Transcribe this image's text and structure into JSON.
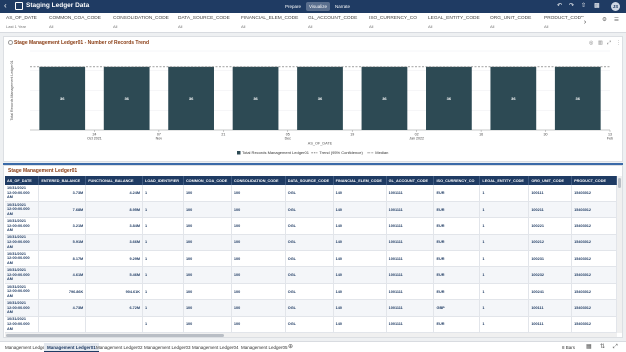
{
  "app": {
    "back_icon": "back-arrow-icon",
    "app_icon": "chart-app-icon",
    "title": "Staging Ledger Data",
    "tabs": [
      {
        "label": "Prepare",
        "active": false
      },
      {
        "label": "Visualize",
        "active": true
      },
      {
        "label": "Narrate",
        "active": false
      }
    ],
    "avatar": "JS",
    "accent": "#1f3b63"
  },
  "filters": [
    {
      "label": "AS_OF_DATE",
      "value": "Last 1 Year"
    },
    {
      "label": "COMMON_COA_CODE",
      "value": "All"
    },
    {
      "label": "CONSOLIDATION_CODE",
      "value": "All"
    },
    {
      "label": "DATA_SOURCE_CODE",
      "value": "All"
    },
    {
      "label": "FINANCIAL_ELEM_CODE",
      "value": "All"
    },
    {
      "label": "GL_ACCOUNT_CODE",
      "value": "All"
    },
    {
      "label": "ISO_CURRENCY_CO",
      "value": "All"
    },
    {
      "label": "LEGAL_ENTITY_CODE",
      "value": "All"
    },
    {
      "label": "ORG_UNIT_CODE",
      "value": "All"
    },
    {
      "label": "PRODUCT_CODE",
      "value": "All"
    }
  ],
  "chart_panel": {
    "title": "Stage Management Ledger01 - Number of Records Trend"
  },
  "chart_data": {
    "type": "bar",
    "categories": [
      "17\nOct 2021",
      "31",
      "14\nNov",
      "28",
      "12\nDec",
      "26",
      "09\nJan 2022",
      "23",
      "06\nFeb",
      "20"
    ],
    "series": [
      {
        "name": "Total Records Management Ledger01",
        "values": [
          36,
          36,
          36,
          36,
          36,
          36,
          36,
          36,
          36,
          36
        ]
      }
    ],
    "tick_labels": [
      {
        "top": "24",
        "bottom": "Oct 2021"
      },
      {
        "top": "07",
        "bottom": "Nov"
      },
      {
        "top": "21",
        "bottom": ""
      },
      {
        "top": "05",
        "bottom": "Dec"
      },
      {
        "top": "19",
        "bottom": ""
      },
      {
        "top": "02",
        "bottom": "Jan 2022"
      },
      {
        "top": "16",
        "bottom": ""
      },
      {
        "top": "30",
        "bottom": ""
      },
      {
        "top": "13",
        "bottom": "Feb"
      }
    ],
    "data_labels": [
      "36",
      "36",
      "36",
      "36",
      "36",
      "36",
      "36",
      "36",
      "36"
    ],
    "values": [
      36,
      36,
      36,
      36,
      36,
      36,
      36,
      36,
      36
    ],
    "trend_value": 36,
    "ylabel": "Total Records Management Ledger01",
    "xlabel": "AS_OF_DATE",
    "ylim": [
      0,
      45
    ],
    "legend": [
      {
        "label": "Total Records Management Ledger01",
        "color": "#2d4a54"
      },
      {
        "label": "Trend (95% Confidence)",
        "color": "#6a6a6a"
      },
      {
        "label": "Median",
        "color": "#9a9a9a"
      }
    ],
    "legend_position": "bottom",
    "bar_color": "#2d4a54",
    "grid": true
  },
  "table": {
    "title": "Stage Management Ledger01",
    "columns": [
      "AS_OF_DATE",
      "ENTERED_BALANCE",
      "FUNCTIONAL_BALANCE",
      "LOAD_IDENTIFIER",
      "COMMON_COA_CODE",
      "CONSOLIDATION_CODE",
      "DATA_SOURCE_CODE",
      "FINANCIAL_ELEM_CODE",
      "GL_ACCOUNT_CODE",
      "ISO_CURRENCY_CO",
      "LEGAL_ENTITY_CODE",
      "ORG_UNIT_CODE",
      "PRODUCT_CODE"
    ],
    "rows": [
      [
        "10/31/2021 12:00:00.000 AM",
        "3.73M",
        "4.24M",
        "1",
        "100",
        "100",
        "OGL",
        "140",
        "1001111",
        "EUR",
        "1",
        "100111",
        "15403012"
      ],
      [
        "10/31/2021 12:00:00.000 AM",
        "7.68M",
        "8.95M",
        "1",
        "100",
        "100",
        "OGL",
        "140",
        "1001111",
        "EUR",
        "1",
        "100211",
        "15403012"
      ],
      [
        "10/31/2021 12:00:00.000 AM",
        "3.21M",
        "3.84M",
        "1",
        "100",
        "100",
        "OGL",
        "140",
        "1001111",
        "EUR",
        "1",
        "100221",
        "15403012"
      ],
      [
        "10/31/2021 12:00:00.000 AM",
        "5.91M",
        "3.66M",
        "1",
        "100",
        "100",
        "OGL",
        "140",
        "1001111",
        "EUR",
        "1",
        "100212",
        "15403012"
      ],
      [
        "10/31/2021 12:00:00.000 AM",
        "8.17M",
        "9.29M",
        "1",
        "100",
        "100",
        "OGL",
        "140",
        "1001111",
        "EUR",
        "1",
        "100231",
        "15403012"
      ],
      [
        "10/31/2021 12:00:00.000 AM",
        "4.61M",
        "5.46M",
        "1",
        "100",
        "100",
        "OGL",
        "140",
        "1001111",
        "EUR",
        "1",
        "100232",
        "15403012"
      ],
      [
        "10/31/2021 12:00:00.000 AM",
        "796.86K",
        "904.61K",
        "1",
        "100",
        "100",
        "OGL",
        "140",
        "1001111",
        "EUR",
        "1",
        "100241",
        "15403012"
      ],
      [
        "10/31/2021 12:00:00.000 AM",
        "4.73M",
        "6.72M",
        "1",
        "100",
        "100",
        "OGL",
        "140",
        "1001111",
        "GBP",
        "1",
        "100111",
        "15403012"
      ],
      [
        "10/31/2021 12:00:00.000 AM",
        "",
        "",
        "1",
        "100",
        "100",
        "OGL",
        "140",
        "1001111",
        "EUR",
        "1",
        "100111",
        "15403012"
      ]
    ]
  },
  "bottom_tabs": [
    {
      "label": "Management Ledger",
      "active": false
    },
    {
      "label": "Management Ledger01",
      "active": true
    },
    {
      "label": "Management Ledger02",
      "active": false
    },
    {
      "label": "Management Ledger03",
      "active": false
    },
    {
      "label": "Management Ledger04",
      "active": false
    },
    {
      "label": "Management Ledger05",
      "active": false
    }
  ],
  "status": {
    "rows_label": "8 Bars"
  }
}
